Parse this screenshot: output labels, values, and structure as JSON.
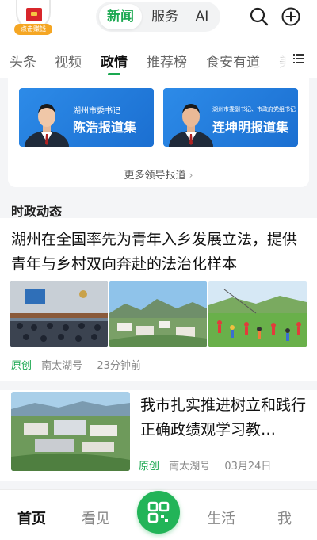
{
  "header": {
    "earn_badge": "点击赚钱",
    "segments": [
      {
        "label": "新闻",
        "active": true
      },
      {
        "label": "服务",
        "active": false
      },
      {
        "label": "AI",
        "active": false
      }
    ],
    "icons": [
      "search-icon",
      "plus-circle-icon"
    ]
  },
  "categories": [
    {
      "label": "头条",
      "active": false
    },
    {
      "label": "视频",
      "active": false
    },
    {
      "label": "政情",
      "active": true
    },
    {
      "label": "推荐榜",
      "active": false
    },
    {
      "label": "食安有道",
      "active": false
    },
    {
      "label": "美",
      "active": false
    }
  ],
  "leaders": {
    "banners": [
      {
        "subtitle": "湖州市委书记",
        "title": "陈浩报道集"
      },
      {
        "subtitle": "湖州市委副书记、市政府党组书记",
        "title": "连坤明报道集"
      }
    ],
    "more_label": "更多领导报道",
    "more_icon": "chevron-right-icon"
  },
  "section": {
    "title": "时政动态"
  },
  "articles": [
    {
      "title": "湖州在全国率先为青年入乡发展立法，提供青年与乡村双向奔赴的法治化样本",
      "tag": "原创",
      "source": "南太湖号",
      "time": "23分钟前"
    },
    {
      "title": "我市扎实推进树立和践行正确政绩观学习教…",
      "tag": "原创",
      "source": "南太湖号",
      "time": "03月24日"
    }
  ],
  "bottom_nav": [
    {
      "label": "首页",
      "active": true
    },
    {
      "label": "看见",
      "active": false
    },
    {
      "label": "",
      "icon": "scan-icon",
      "active": false
    },
    {
      "label": "生活",
      "active": false
    },
    {
      "label": "我",
      "active": false
    }
  ],
  "colors": {
    "accent": "#1aa850",
    "banner_blue": "#1b6fd1",
    "badge": "#f5a623",
    "page_bg": "#f4f5f7"
  }
}
